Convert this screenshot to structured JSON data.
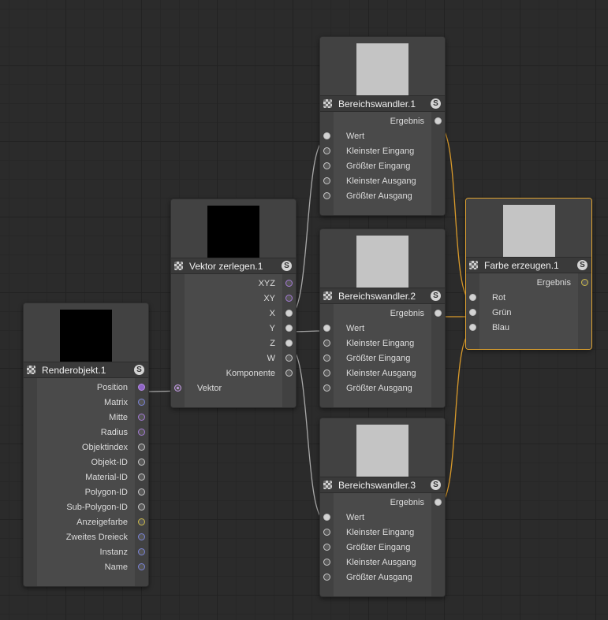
{
  "nodes": {
    "renderobjekt": {
      "title": "Renderobjekt.1",
      "outputs": [
        "Position",
        "Matrix",
        "Mitte",
        "Radius",
        "Objektindex",
        "Objekt-ID",
        "Material-ID",
        "Polygon-ID",
        "Sub-Polygon-ID",
        "Anzeigefarbe",
        "Zweites Dreieck",
        "Instanz",
        "Name"
      ],
      "preview_color": "#000000"
    },
    "vektor": {
      "title": "Vektor zerlegen.1",
      "outputs": [
        "XYZ",
        "XY",
        "X",
        "Y",
        "Z",
        "W",
        "Komponente"
      ],
      "inputs": [
        "Vektor"
      ],
      "preview_color": "#000000"
    },
    "bw1": {
      "title": "Bereichswandler.1",
      "output": "Ergebnis",
      "inputs": [
        "Wert",
        "Kleinster Eingang",
        "Größter Eingang",
        "Kleinster Ausgang",
        "Größter Ausgang"
      ],
      "preview_color": "#c4c4c4"
    },
    "bw2": {
      "title": "Bereichswandler.2",
      "output": "Ergebnis",
      "inputs": [
        "Wert",
        "Kleinster Eingang",
        "Größter Eingang",
        "Kleinster Ausgang",
        "Größter Ausgang"
      ],
      "preview_color": "#c4c4c4"
    },
    "bw3": {
      "title": "Bereichswandler.3",
      "output": "Ergebnis",
      "inputs": [
        "Wert",
        "Kleinster Eingang",
        "Größter Eingang",
        "Kleinster Ausgang",
        "Größter Ausgang"
      ],
      "preview_color": "#c4c4c4"
    },
    "farbe": {
      "title": "Farbe erzeugen.1",
      "output": "Ergebnis",
      "inputs": [
        "Rot",
        "Grün",
        "Blau"
      ],
      "preview_color": "#c4c4c4"
    }
  },
  "colors": {
    "wire": "#a8a8a8",
    "wire_selected": "#d99a2b",
    "selection": "#e3a531"
  },
  "icons": {
    "node_type": "checker-icon",
    "solo": "s-icon",
    "solo_label": "S"
  }
}
